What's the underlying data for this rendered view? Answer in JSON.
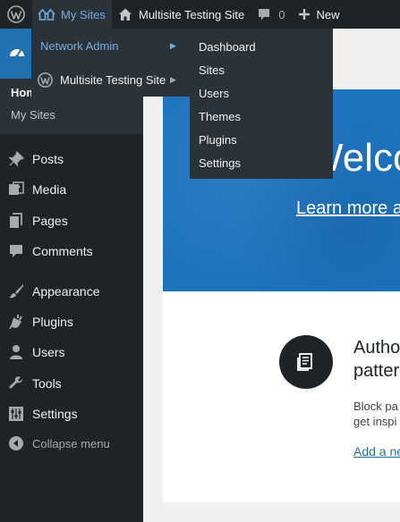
{
  "admin_bar": {
    "wp_logo_icon": "wordpress-icon",
    "my_sites_label": "My Sites",
    "site_name": "Multisite Testing Site",
    "comments_count": "0",
    "new_label": "New"
  },
  "my_sites_menu": {
    "network_admin_label": "Network Admin",
    "site_label": "Multisite Testing Site"
  },
  "network_admin_submenu": [
    "Dashboard",
    "Sites",
    "Users",
    "Themes",
    "Plugins",
    "Settings"
  ],
  "sidebar": {
    "dashboard_icon": "dashboard-icon",
    "submenu_home": "Hom",
    "submenu_my_sites": "My Sites",
    "items": [
      {
        "label": "Posts",
        "icon": "pushpin-icon"
      },
      {
        "label": "Media",
        "icon": "media-icon"
      },
      {
        "label": "Pages",
        "icon": "pages-icon"
      },
      {
        "label": "Comments",
        "icon": "comment-icon"
      },
      {
        "label": "Appearance",
        "icon": "paintbrush-icon"
      },
      {
        "label": "Plugins",
        "icon": "plugin-icon"
      },
      {
        "label": "Users",
        "icon": "user-icon"
      },
      {
        "label": "Tools",
        "icon": "wrench-icon"
      },
      {
        "label": "Settings",
        "icon": "settings-icon"
      },
      {
        "label": "Collapse menu",
        "icon": "collapse-icon"
      }
    ]
  },
  "welcome": {
    "title": "Welco",
    "learn_more": "Learn more a"
  },
  "block_patterns": {
    "title_line1": "Autho",
    "title_line2": "patter",
    "desc_line1": "Block pa",
    "desc_line2": "get inspi",
    "link": "Add a ne"
  },
  "colors": {
    "admin_bar_bg": "#1d2327",
    "menu_highlight": "#2271b1",
    "link_blue": "#72aee6",
    "welcome_blue": "#1e73be"
  }
}
